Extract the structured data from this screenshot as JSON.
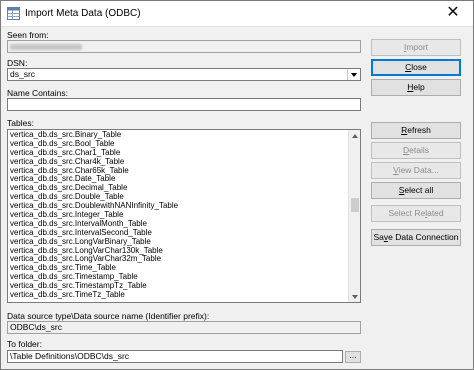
{
  "window": {
    "title": "Import Meta Data (ODBC)",
    "close_glyph": "✕"
  },
  "seen_from": {
    "label": "Seen from:"
  },
  "dsn": {
    "label": "DSN:",
    "value": "ds_src"
  },
  "name_contains": {
    "label": "Name Contains:",
    "value": ""
  },
  "tables": {
    "label": "Tables:",
    "items": [
      "vertica_db.ds_src.Binary_Table",
      "vertica_db.ds_src.Bool_Table",
      "vertica_db.ds_src.Char1_Table",
      "vertica_db.ds_src.Char4k_Table",
      "vertica_db.ds_src.Char65k_Table",
      "vertica_db.ds_src.Date_Table",
      "vertica_db.ds_src.Decimal_Table",
      "vertica_db.ds_src.Double_Table",
      "vertica_db.ds_src.DoublewithNANInfinity_Table",
      "vertica_db.ds_src.Integer_Table",
      "vertica_db.ds_src.IntervalMonth_Table",
      "vertica_db.ds_src.IntervalSecond_Table",
      "vertica_db.ds_src.LongVarBinary_Table",
      "vertica_db.ds_src.LongVarChar130k_Table",
      "vertica_db.ds_src.LongVarChar32m_Table",
      "vertica_db.ds_src.Time_Table",
      "vertica_db.ds_src.Timestamp_Table",
      "vertica_db.ds_src.TimestampTz_Table",
      "vertica_db.ds_src.TimeTz_Table"
    ]
  },
  "data_source_type": {
    "label": "Data source type\\Data source name (Identifier prefix):",
    "value": "ODBC\\ds_src"
  },
  "to_folder": {
    "label": "To folder:",
    "value": "\\Table Definitions\\ODBC\\ds_src",
    "browse_label": "..."
  },
  "buttons": {
    "import": {
      "pre": "",
      "ul": "I",
      "post": "mport"
    },
    "close": {
      "pre": "",
      "ul": "C",
      "post": "lose"
    },
    "help": {
      "pre": "",
      "ul": "H",
      "post": "elp"
    },
    "refresh": {
      "pre": "",
      "ul": "R",
      "post": "efresh"
    },
    "details": {
      "pre": "",
      "ul": "D",
      "post": "etails"
    },
    "view_data": {
      "pre": "",
      "ul": "V",
      "post": "iew Data..."
    },
    "select_all": {
      "pre": "",
      "ul": "S",
      "post": "elect all"
    },
    "select_related": {
      "pre": "Select Re",
      "ul": "l",
      "post": "ated"
    },
    "save_connection": {
      "pre": "Sa",
      "ul": "v",
      "post": "e Data Connection"
    }
  }
}
